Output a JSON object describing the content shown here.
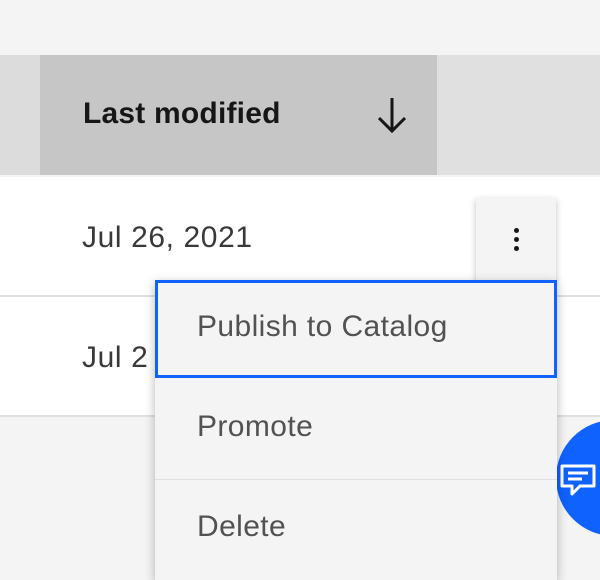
{
  "table": {
    "sort_header": {
      "label": "Last modified",
      "sort_direction": "descending",
      "icon": "arrow-down-icon"
    },
    "rows": [
      {
        "last_modified": "Jul 26, 2021"
      },
      {
        "last_modified": "Jul 2"
      }
    ]
  },
  "overflow_menu": {
    "trigger_icon": "overflow-menu-vertical-icon",
    "items": [
      {
        "label": "Publish to Catalog",
        "focused": true
      },
      {
        "label": "Promote",
        "focused": false
      },
      {
        "label": "Delete",
        "focused": false
      }
    ]
  },
  "chat_button": {
    "icon": "chat-icon"
  },
  "colors": {
    "accent": "#0f62fe",
    "header_bg": "#e0e0e0",
    "sorted_header_bg": "#c6c6c6",
    "menu_bg": "#f4f4f4",
    "text_primary": "#161616",
    "text_secondary": "#525252"
  }
}
